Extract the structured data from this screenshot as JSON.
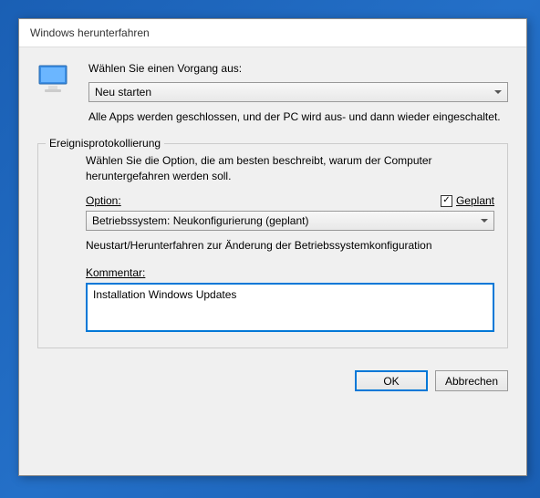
{
  "window": {
    "title": "Windows herunterfahren"
  },
  "action": {
    "prompt": "Wählen Sie einen Vorgang aus:",
    "selected": "Neu starten",
    "help": "Alle Apps werden geschlossen, und der PC wird aus- und dann wieder eingeschaltet."
  },
  "tracker": {
    "legend": "Ereignisprotokollierung",
    "desc": "Wählen Sie die Option, die am besten beschreibt, warum der Computer heruntergefahren werden soll.",
    "option_label": "Option:",
    "planned_label": "Geplant",
    "planned_checked": "✓",
    "selected_reason": "Betriebssystem: Neukonfigurierung (geplant)",
    "reason_help": "Neustart/Herunterfahren zur Änderung der Betriebssystemkonfiguration",
    "comment_label": "Kommentar:",
    "comment_value": "Installation Windows Updates"
  },
  "buttons": {
    "ok": "OK",
    "cancel": "Abbrechen"
  }
}
